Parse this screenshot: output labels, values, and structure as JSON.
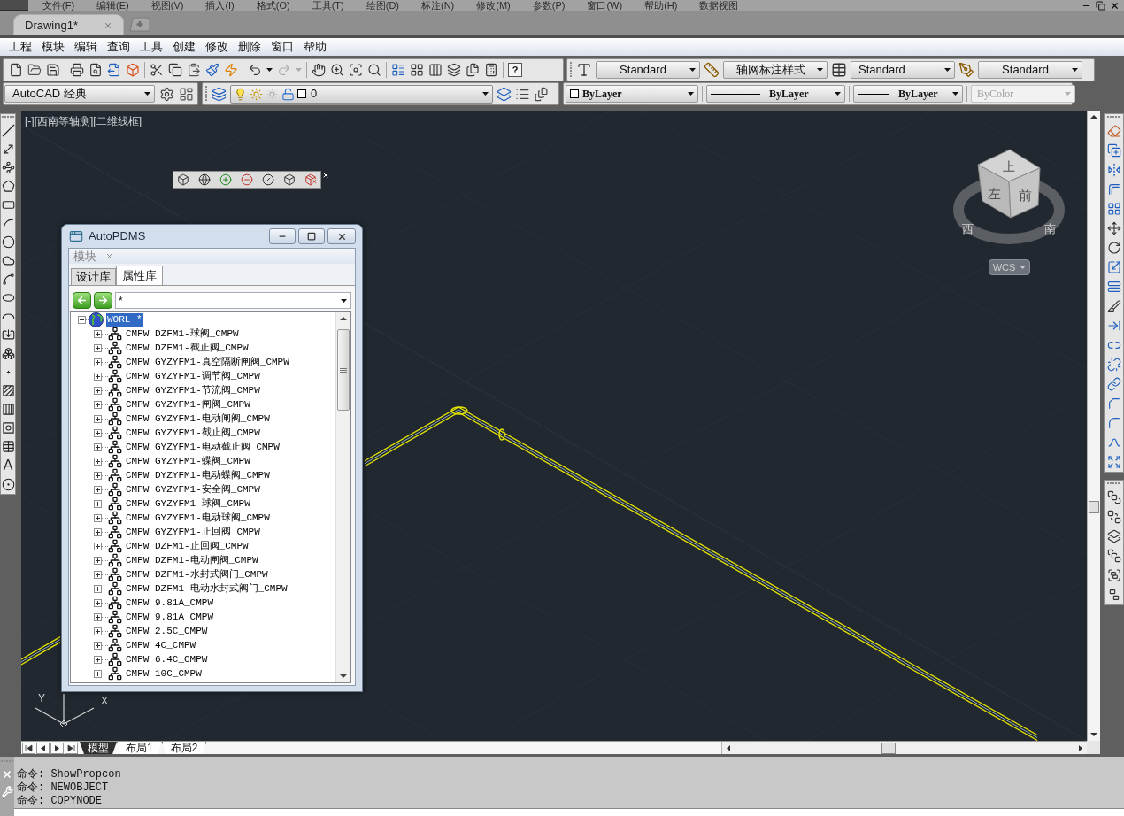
{
  "menu_bar": {
    "items": [
      "文件(F)",
      "编辑(E)",
      "视图(V)",
      "插入(I)",
      "格式(O)",
      "工具(T)",
      "绘图(D)",
      "标注(N)",
      "修改(M)",
      "参数(P)",
      "窗口(W)",
      "帮助(H)",
      "数据视图"
    ]
  },
  "document_tabs": [
    {
      "label": "Drawing1*",
      "selected": true
    }
  ],
  "app_menu": {
    "items": [
      "工程",
      "模块",
      "编辑",
      "查询",
      "工具",
      "创建",
      "修改",
      "删除",
      "窗口",
      "帮助"
    ]
  },
  "standard_toolbar": {
    "help": "?"
  },
  "style_toolbar": {
    "dropdowns": [
      {
        "value": "Standard"
      },
      {
        "value": "轴网标注样式"
      },
      {
        "value": "Standard"
      },
      {
        "value": "Standard"
      }
    ]
  },
  "workspace_toolbar": {
    "value": "AutoCAD 经典"
  },
  "layer_toolbar": {
    "layer": "0",
    "on": true,
    "frozen": false,
    "locked": false
  },
  "properties_toolbar": {
    "color_control": "ByLayer",
    "linetype": "ByLayer",
    "lineweight": "ByLayer",
    "plot_style": {
      "value": "ByColor",
      "disabled": true
    }
  },
  "draw_toolbar": {
    "text_tool": "A"
  },
  "viewport": {
    "label": "[-][西南等轴测][二维线框]",
    "view_cube": {
      "top": "上",
      "left": "左",
      "front": "前",
      "compass": [
        "西",
        "南"
      ],
      "ucs_menu": "WCS"
    },
    "ucs_icon": {
      "x": "X",
      "y": "Y"
    }
  },
  "dialog": {
    "title": "AutoPDMS",
    "panel": "模块",
    "tabs": [
      {
        "label": "设计库",
        "selected": false
      },
      {
        "label": "属性库",
        "selected": true
      }
    ],
    "filter": {
      "value": "*"
    },
    "tree": [
      {
        "label": "WORL *",
        "expanded": true,
        "selected": true,
        "children": [
          {
            "label": "CMPW DZFM1-球阀_CMPW",
            "expanded": false,
            "selected": false
          },
          {
            "label": "CMPW DZFM1-截止阀_CMPW",
            "expanded": false,
            "selected": false
          },
          {
            "label": "CMPW GYZYFM1-真空隔断闸阀_CMPW",
            "expanded": false,
            "selected": false
          },
          {
            "label": "CMPW GYZYFM1-调节阀_CMPW",
            "expanded": false,
            "selected": false
          },
          {
            "label": "CMPW GYZYFM1-节流阀_CMPW",
            "expanded": false,
            "selected": false
          },
          {
            "label": "CMPW GYZYFM1-闸阀_CMPW",
            "expanded": false,
            "selected": false
          },
          {
            "label": "CMPW GYZYFM1-电动闸阀_CMPW",
            "expanded": false,
            "selected": false
          },
          {
            "label": "CMPW GYZYFM1-截止阀_CMPW",
            "expanded": false,
            "selected": false
          },
          {
            "label": "CMPW GYZYFM1-电动截止阀_CMPW",
            "expanded": false,
            "selected": false
          },
          {
            "label": "CMPW GYZYFM1-蝶阀_CMPW",
            "expanded": false,
            "selected": false
          },
          {
            "label": "CMPW DYZYFM1-电动蝶阀_CMPW",
            "expanded": false,
            "selected": false
          },
          {
            "label": "CMPW GYZYFM1-安全阀_CMPW",
            "expanded": false,
            "selected": false
          },
          {
            "label": "CMPW GYZYFM1-球阀_CMPW",
            "expanded": false,
            "selected": false
          },
          {
            "label": "CMPW GYZYFM1-电动球阀_CMPW",
            "expanded": false,
            "selected": false
          },
          {
            "label": "CMPW GYZYFM1-止回阀_CMPW",
            "expanded": false,
            "selected": false
          },
          {
            "label": "CMPW DZFM1-止回阀_CMPW",
            "expanded": false,
            "selected": false
          },
          {
            "label": "CMPW DZFM1-电动闸阀_CMPW",
            "expanded": false,
            "selected": false
          },
          {
            "label": "CMPW DZFM1-水封式阀门_CMPW",
            "expanded": false,
            "selected": false
          },
          {
            "label": "CMPW DZFM1-电动水封式阀门_CMPW",
            "expanded": false,
            "selected": false
          },
          {
            "label": "CMPW 9.81A_CMPW",
            "expanded": false,
            "selected": false
          },
          {
            "label": "CMPW 9.81A_CMPW",
            "expanded": false,
            "selected": false
          },
          {
            "label": "CMPW 2.5C_CMPW",
            "expanded": false,
            "selected": false
          },
          {
            "label": "CMPW 4C_CMPW",
            "expanded": false,
            "selected": false
          },
          {
            "label": "CMPW 6.4C_CMPW",
            "expanded": false,
            "selected": false
          },
          {
            "label": "CMPW 10C_CMPW",
            "expanded": false,
            "selected": false
          }
        ]
      }
    ]
  },
  "layout_tabs": [
    {
      "label": "模型",
      "selected": true
    },
    {
      "label": "布局1",
      "selected": false
    },
    {
      "label": "布局2",
      "selected": false
    }
  ],
  "command_line": {
    "history": [
      "命令: ShowPropcon",
      "命令: NEWOBJECT",
      "命令: COPYNODE"
    ]
  }
}
